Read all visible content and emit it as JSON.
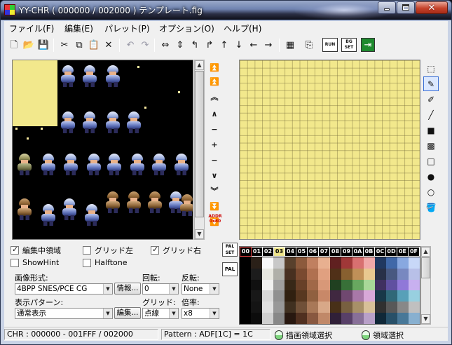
{
  "window": {
    "title": "YY-CHR ( 000000 / 002000 ) テンプレート.fig",
    "controls": {
      "minimize": "minimize",
      "maximize": "maximize",
      "close": "✕"
    }
  },
  "menu": [
    "ファイル(F)",
    "編集(E)",
    "パレット(P)",
    "オプション(O)",
    "ヘルプ(H)"
  ],
  "toolbar": [
    {
      "name": "new-file-icon",
      "glyph": "🗋"
    },
    {
      "name": "open-folder-icon",
      "glyph": "📂"
    },
    {
      "name": "save-icon",
      "glyph": "💾"
    },
    {
      "name": "cut-icon",
      "glyph": "✂"
    },
    {
      "name": "copy-icon",
      "glyph": "⧉"
    },
    {
      "name": "paste-icon",
      "glyph": "📋"
    },
    {
      "name": "delete-icon",
      "glyph": "✕"
    },
    {
      "name": "undo-icon",
      "glyph": "↶"
    },
    {
      "name": "redo-icon",
      "glyph": "↷"
    },
    {
      "name": "flip-horizontal-icon",
      "glyph": "⇔"
    },
    {
      "name": "flip-vertical-icon",
      "glyph": "⇕"
    },
    {
      "name": "rotate-left-icon",
      "glyph": "↰"
    },
    {
      "name": "rotate-right-icon",
      "glyph": "↱"
    },
    {
      "name": "shift-up-icon",
      "glyph": "↑"
    },
    {
      "name": "shift-down-icon",
      "glyph": "↓"
    },
    {
      "name": "shift-left-icon",
      "glyph": "←"
    },
    {
      "name": "shift-right-icon",
      "glyph": "→"
    },
    {
      "name": "color-replace-icon",
      "glyph": "▦"
    },
    {
      "name": "export-icon",
      "glyph": "⎘"
    },
    {
      "name": "run-icon",
      "glyph": "RUN"
    },
    {
      "name": "bg-set-icon",
      "glyph": "BG SET"
    },
    {
      "name": "exit-icon",
      "glyph": "⇥"
    }
  ],
  "nav": [
    {
      "name": "jump-top-button",
      "glyph": "⏫",
      "blue": false
    },
    {
      "name": "page-up-fast-button",
      "glyph": "⏫",
      "blue": true
    },
    {
      "name": "page-up-button",
      "glyph": "︽",
      "blue": false
    },
    {
      "name": "line-up-button",
      "glyph": "∧",
      "blue": false
    },
    {
      "name": "step-up-button",
      "glyph": "−",
      "blue": false
    },
    {
      "name": "step-plus-button",
      "glyph": "+",
      "blue": false
    },
    {
      "name": "step-minus-button",
      "glyph": "−",
      "blue": false
    },
    {
      "name": "line-down-button",
      "glyph": "∨",
      "blue": false
    },
    {
      "name": "page-down-button",
      "glyph": "︾",
      "blue": false
    },
    {
      "name": "page-down-fast-button",
      "glyph": "⏬",
      "blue": true
    },
    {
      "name": "jump-bottom-button",
      "glyph": "⏬",
      "blue": false
    }
  ],
  "addr_label": "ADDR 0x80",
  "tools": [
    {
      "name": "select-tool-icon",
      "glyph": "⬚",
      "active": false
    },
    {
      "name": "pen-tool-icon",
      "glyph": "✎",
      "active": true
    },
    {
      "name": "pen-alt-tool-icon",
      "glyph": "✐",
      "active": false
    },
    {
      "name": "line-tool-icon",
      "glyph": "╱",
      "active": false
    },
    {
      "name": "filled-rect-tool-icon",
      "glyph": "■",
      "active": false
    },
    {
      "name": "pattern-rect-tool-icon",
      "glyph": "▩",
      "active": false
    },
    {
      "name": "rect-tool-icon",
      "glyph": "□",
      "active": false
    },
    {
      "name": "filled-circle-tool-icon",
      "glyph": "●",
      "active": false
    },
    {
      "name": "circle-tool-icon",
      "glyph": "○",
      "active": false
    },
    {
      "name": "fill-bucket-tool-icon",
      "glyph": "🪣",
      "active": false
    }
  ],
  "options": {
    "edit_area": {
      "label": "編集中領域",
      "checked": true
    },
    "grid_left": {
      "label": "グリッド左",
      "checked": false
    },
    "grid_right": {
      "label": "グリッド右",
      "checked": true
    },
    "show_hint": {
      "label": "ShowHint",
      "checked": false
    },
    "halftone": {
      "label": "Halftone",
      "checked": false
    }
  },
  "format": {
    "image_format_label": "画像形式:",
    "image_format_value": "4BPP SNES/PCE CG",
    "info_button": "情報...",
    "rotation_label": "回転:",
    "rotation_value": "0",
    "flip_label": "反転:",
    "flip_value": "None",
    "pattern_label": "表示パターン:",
    "pattern_value": "通常表示",
    "edit_button": "編集...",
    "grid_label": "グリッド:",
    "grid_value": "点線",
    "zoom_label": "倍率:",
    "zoom_value": "x8"
  },
  "pal_set_label": "PAL SET",
  "pal_label": "PAL",
  "palette_header": [
    "00",
    "01",
    "02",
    "03",
    "04",
    "05",
    "06",
    "07",
    "08",
    "09",
    "0A",
    "0B",
    "0C",
    "0D",
    "0E",
    "0F"
  ],
  "palette_rows": [
    [
      "#000000",
      "#2a2018",
      "#f8f8f8",
      "#c8c8c8",
      "#58402c",
      "#8c5a3c",
      "#c08060",
      "#e8b090",
      "#602020",
      "#a03838",
      "#d87070",
      "#f0a8a8",
      "#203860",
      "#4068a8",
      "#88a8e0",
      "#c8d8f8"
    ],
    [
      "#000000",
      "#1c1c1c",
      "#e8e8e0",
      "#b0b0a8",
      "#483020",
      "#7a4a30",
      "#b07050",
      "#e0a080",
      "#503018",
      "#886030",
      "#c09058",
      "#e8c890",
      "#283048",
      "#485880",
      "#7888c0",
      "#b8c0e8"
    ],
    [
      "#000000",
      "#101010",
      "#f0f0f0",
      "#a0a0a0",
      "#382818",
      "#684028",
      "#a06848",
      "#d89878",
      "#204020",
      "#387038",
      "#68a860",
      "#a8d898",
      "#403060",
      "#6050a0",
      "#9078d8",
      "#c8b0f0"
    ],
    [
      "#000000",
      "#181818",
      "#d8d8d8",
      "#909090",
      "#302010",
      "#583820",
      "#906040",
      "#c88868",
      "#402840",
      "#704870",
      "#a878a8",
      "#d8a8d8",
      "#183848",
      "#306878",
      "#58a0b8",
      "#98d0e0"
    ],
    [
      "#000000",
      "#141414",
      "#e0e0e0",
      "#989898",
      "#403020",
      "#705038",
      "#a87858",
      "#d8a888",
      "#483018",
      "#786040",
      "#a89068",
      "#d8c098",
      "#303030",
      "#585858",
      "#888888",
      "#c0c0c0"
    ],
    [
      "#000000",
      "#0c0c0c",
      "#d0d0d0",
      "#888888",
      "#281810",
      "#503020",
      "#885840",
      "#c08868",
      "#302038",
      "#584068",
      "#887098",
      "#b8a0c8",
      "#102838",
      "#285068",
      "#487898",
      "#88b0d0"
    ]
  ],
  "status": {
    "chr": "CHR : 000000 - 001FFF / 002000",
    "pattern": "Pattern : ADF[1C] = 1C",
    "draw_area": "描画領域選択",
    "area": "領域選択"
  }
}
